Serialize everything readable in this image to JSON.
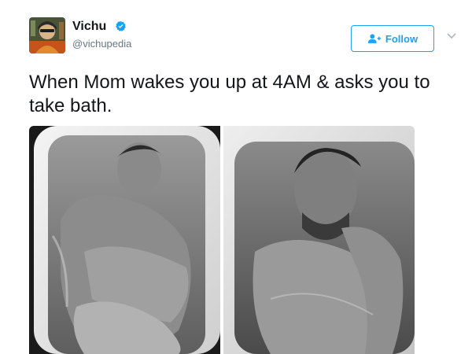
{
  "tweet": {
    "author": {
      "display_name": "Vichu",
      "handle": "@vichupedia",
      "verified": true,
      "avatar_icon": "profile-avatar"
    },
    "follow_label": "Follow",
    "follow_icon": "add-user-icon",
    "menu_icon": "chevron-down-icon",
    "text": "When Mom wakes you up at 4AM & asks you to take bath.",
    "media": {
      "photos": [
        {
          "icon": "photo-man-curled-in-bathtub"
        },
        {
          "icon": "photo-man-closeup-in-bathtub"
        }
      ]
    }
  },
  "colors": {
    "accent": "#1da1f2",
    "text": "#14171a",
    "secondary_text": "#657786"
  }
}
